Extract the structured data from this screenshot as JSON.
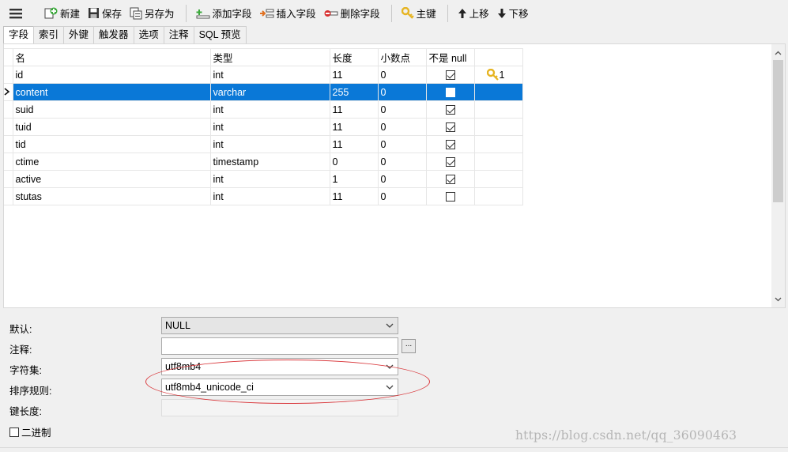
{
  "toolbar": {
    "new": "新建",
    "save": "保存",
    "save_as": "另存为",
    "add_field": "添加字段",
    "insert_field": "插入字段",
    "delete_field": "删除字段",
    "primary_key": "主键",
    "move_up": "上移",
    "move_down": "下移"
  },
  "tabs": [
    "字段",
    "索引",
    "外键",
    "触发器",
    "选项",
    "注释",
    "SQL 预览"
  ],
  "columns": [
    "名",
    "类型",
    "长度",
    "小数点",
    "不是 null",
    ""
  ],
  "rows": [
    {
      "name": "id",
      "type": "int",
      "length": "11",
      "decimals": "0",
      "not_null": true,
      "key": "1"
    },
    {
      "name": "content",
      "type": "varchar",
      "length": "255",
      "decimals": "0",
      "not_null": false,
      "key": ""
    },
    {
      "name": "suid",
      "type": "int",
      "length": "11",
      "decimals": "0",
      "not_null": true,
      "key": ""
    },
    {
      "name": "tuid",
      "type": "int",
      "length": "11",
      "decimals": "0",
      "not_null": true,
      "key": ""
    },
    {
      "name": "tid",
      "type": "int",
      "length": "11",
      "decimals": "0",
      "not_null": true,
      "key": ""
    },
    {
      "name": "ctime",
      "type": "timestamp",
      "length": "0",
      "decimals": "0",
      "not_null": true,
      "key": ""
    },
    {
      "name": "active",
      "type": "int",
      "length": "1",
      "decimals": "0",
      "not_null": true,
      "key": ""
    },
    {
      "name": "stutas",
      "type": "int",
      "length": "11",
      "decimals": "0",
      "not_null": false,
      "key": ""
    }
  ],
  "props": {
    "default_label": "默认:",
    "default_value": "NULL",
    "comment_label": "注释:",
    "comment_value": "",
    "comment_button": "...",
    "charset_label": "字符集:",
    "charset_value": "utf8mb4",
    "collation_label": "排序规则:",
    "collation_value": "utf8mb4_unicode_ci",
    "key_length_label": "键长度:",
    "key_length_value": "",
    "binary_label": "二进制"
  },
  "watermark": "https://blog.csdn.net/qq_36090463",
  "colors": {
    "selection": "#0a78d7",
    "annotation": "#d9383c",
    "key_icon": "#e6b422"
  }
}
